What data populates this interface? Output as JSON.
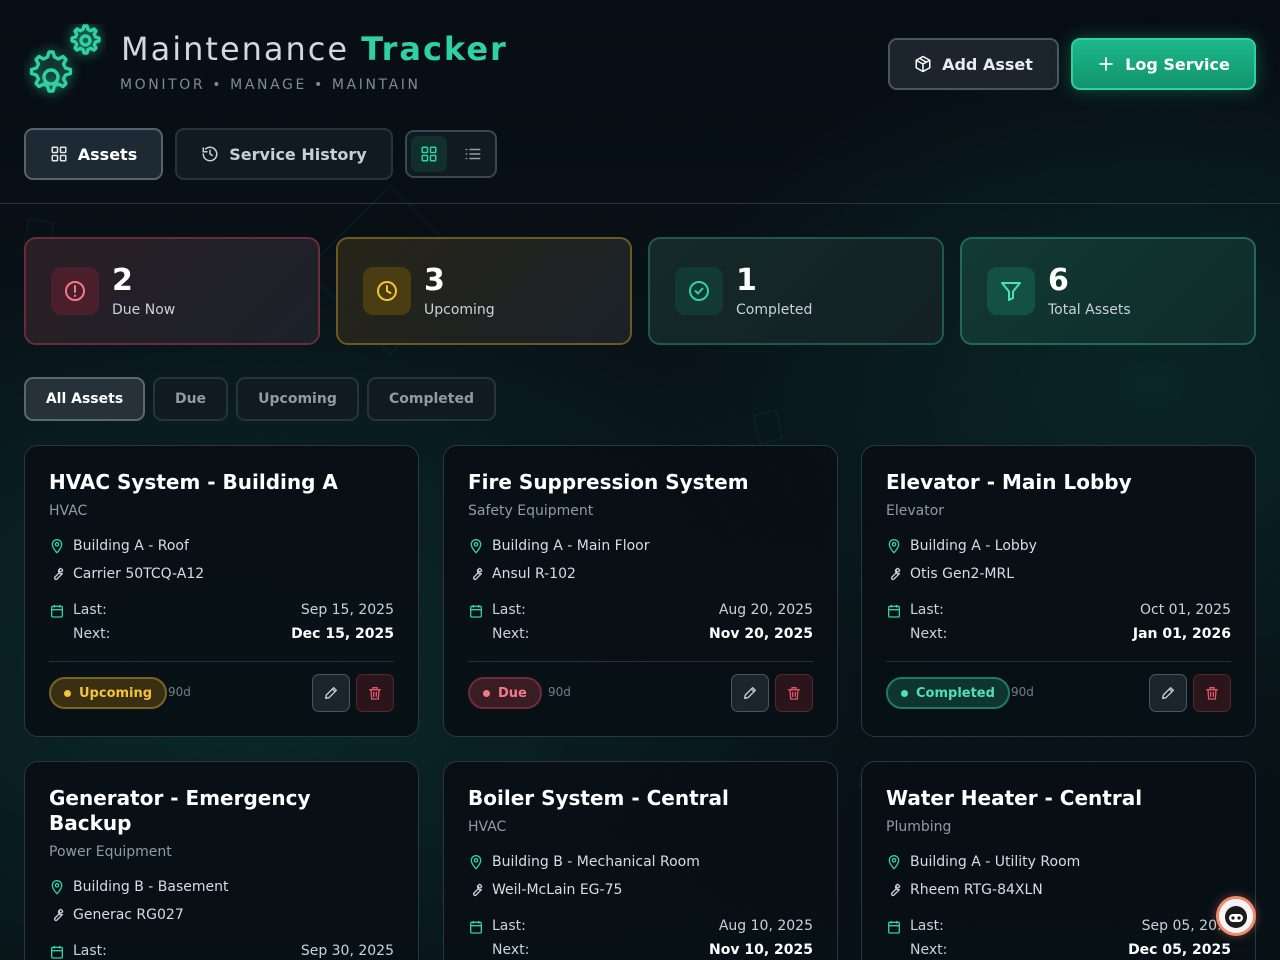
{
  "header": {
    "title_main": "Maintenance",
    "title_accent": "Tracker",
    "subtitle": "MONITOR • MANAGE • MAINTAIN",
    "add_asset_label": "Add Asset",
    "log_service_label": "Log Service"
  },
  "tabs": {
    "assets_label": "Assets",
    "history_label": "Service History",
    "view_mode": "grid"
  },
  "stats": {
    "due": {
      "value": "2",
      "label": "Due Now"
    },
    "upcoming": {
      "value": "3",
      "label": "Upcoming"
    },
    "completed": {
      "value": "1",
      "label": "Completed"
    },
    "total": {
      "value": "6",
      "label": "Total Assets"
    }
  },
  "filters": {
    "all": "All Assets",
    "due": "Due",
    "upcoming": "Upcoming",
    "completed": "Completed",
    "active": "all"
  },
  "common": {
    "last_label": "Last:",
    "next_label": "Next:"
  },
  "colors": {
    "accent": "#2fd1a0",
    "due": "#f27a86",
    "upcoming": "#f2c43d",
    "completed": "#4fe0b5"
  },
  "assets": [
    {
      "name": "HVAC System - Building A",
      "category": "HVAC",
      "location": "Building A - Roof",
      "model": "Carrier 50TCQ-A12",
      "last": "Sep 15, 2025",
      "next": "Dec 15, 2025",
      "status": "Upcoming",
      "interval": "90d"
    },
    {
      "name": "Fire Suppression System",
      "category": "Safety Equipment",
      "location": "Building A - Main Floor",
      "model": "Ansul R-102",
      "last": "Aug 20, 2025",
      "next": "Nov 20, 2025",
      "status": "Due",
      "interval": "90d"
    },
    {
      "name": "Elevator - Main Lobby",
      "category": "Elevator",
      "location": "Building A - Lobby",
      "model": "Otis Gen2-MRL",
      "last": "Oct 01, 2025",
      "next": "Jan 01, 2026",
      "status": "Completed",
      "interval": "90d"
    },
    {
      "name": "Generator - Emergency Backup",
      "category": "Power Equipment",
      "location": "Building B - Basement",
      "model": "Generac RG027",
      "last": "Sep 30, 2025",
      "next": "",
      "status": "",
      "interval": ""
    },
    {
      "name": "Boiler System - Central",
      "category": "HVAC",
      "location": "Building B - Mechanical Room",
      "model": "Weil-McLain EG-75",
      "last": "Aug 10, 2025",
      "next": "Nov 10, 2025",
      "status": "",
      "interval": ""
    },
    {
      "name": "Water Heater - Central",
      "category": "Plumbing",
      "location": "Building A - Utility Room",
      "model": "Rheem RTG-84XLN",
      "last": "Sep 05, 20…",
      "next": "Dec 05, 2025",
      "status": "",
      "interval": ""
    }
  ]
}
